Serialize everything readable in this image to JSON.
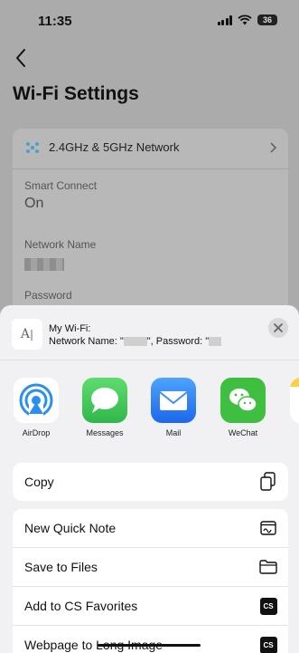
{
  "status_bar": {
    "time": "11:35",
    "battery": "36"
  },
  "page": {
    "title": "Wi-Fi Settings",
    "network_row": "2.4GHz & 5GHz Network",
    "smart_connect_label": "Smart Connect",
    "smart_connect_value": "On",
    "network_name_label": "Network Name",
    "password_label": "Password"
  },
  "share_sheet": {
    "title": "My Wi-Fi:",
    "subtitle_prefix": "Network Name: \"",
    "subtitle_mid": "\", Password: \"",
    "thumb_text": "A",
    "apps": [
      {
        "label": "AirDrop",
        "icon": "airdrop-icon"
      },
      {
        "label": "Messages",
        "icon": "messages-icon"
      },
      {
        "label": "Mail",
        "icon": "mail-icon"
      },
      {
        "label": "WeChat",
        "icon": "wechat-icon"
      }
    ],
    "copy_label": "Copy",
    "actions": [
      {
        "label": "New Quick Note",
        "icon": "quick-note-icon"
      },
      {
        "label": "Save to Files",
        "icon": "folder-icon"
      },
      {
        "label": "Add to CS Favorites",
        "icon": "cs-icon"
      },
      {
        "label": "Webpage to Long Image",
        "icon": "cs-icon"
      }
    ],
    "cs_badge_text": "CS"
  },
  "colors": {
    "airdrop": "#2a8ff0",
    "messages": "#34c759",
    "mail": "#2f7bf6",
    "wechat": "#3fbf3f",
    "accent_network": "#4aa0c8"
  }
}
